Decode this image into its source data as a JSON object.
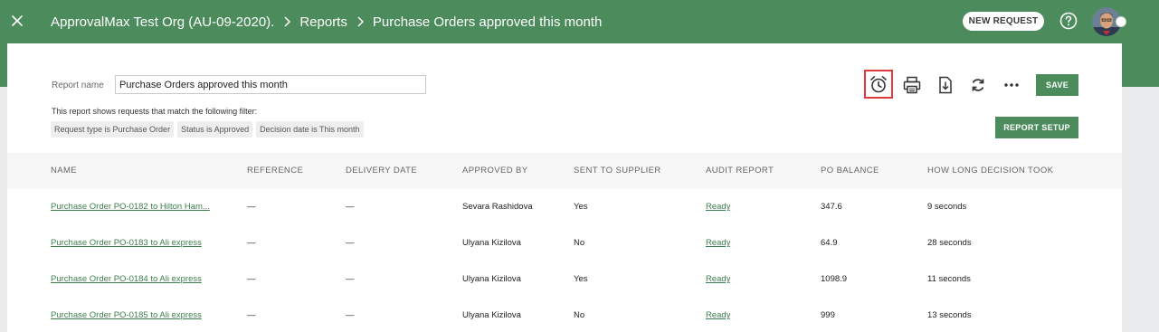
{
  "header": {
    "org": "ApprovalMax Test Org (AU-09-2020).",
    "crumb_reports": "Reports",
    "crumb_current": "Purchase Orders approved this month",
    "new_request": "NEW REQUEST"
  },
  "report": {
    "name_label": "Report name",
    "name_value": "Purchase Orders approved this month",
    "filter_desc": "This report shows requests that match the following filter:",
    "filters": [
      "Request type is Purchase Order",
      "Status is Approved",
      "Decision date is This month"
    ],
    "save_label": "SAVE",
    "setup_label": "REPORT SETUP"
  },
  "toolbar_icons": [
    "alarm-clock-icon",
    "print-icon",
    "download-icon",
    "refresh-icon",
    "more-icon"
  ],
  "table": {
    "columns": [
      "NAME",
      "REFERENCE",
      "DELIVERY DATE",
      "APPROVED BY",
      "SENT TO SUPPLIER",
      "AUDIT REPORT",
      "PO BALANCE",
      "HOW LONG DECISION TOOK"
    ],
    "rows": [
      {
        "name": "Purchase Order PO-0182 to Hilton Ham...",
        "reference": "—",
        "delivery": "—",
        "approved_by": "Sevara Rashidova",
        "sent": "Yes",
        "audit": "Ready",
        "balance": "347.6",
        "duration": "9 seconds"
      },
      {
        "name": "Purchase Order PO-0183 to Ali express",
        "reference": "—",
        "delivery": "—",
        "approved_by": "Ulyana Kizilova",
        "sent": "No",
        "audit": "Ready",
        "balance": "64.9",
        "duration": "28 seconds"
      },
      {
        "name": "Purchase Order PO-0184 to Ali express",
        "reference": "—",
        "delivery": "—",
        "approved_by": "Ulyana Kizilova",
        "sent": "Yes",
        "audit": "Ready",
        "balance": "1098.9",
        "duration": "11 seconds"
      },
      {
        "name": "Purchase Order PO-0185 to Ali express",
        "reference": "—",
        "delivery": "—",
        "approved_by": "Ulyana Kizilova",
        "sent": "No",
        "audit": "Ready",
        "balance": "999",
        "duration": "13 seconds"
      }
    ]
  },
  "colors": {
    "brand": "#4c8c5c",
    "link": "#3d7e4f",
    "highlight": "#e23a3a"
  }
}
